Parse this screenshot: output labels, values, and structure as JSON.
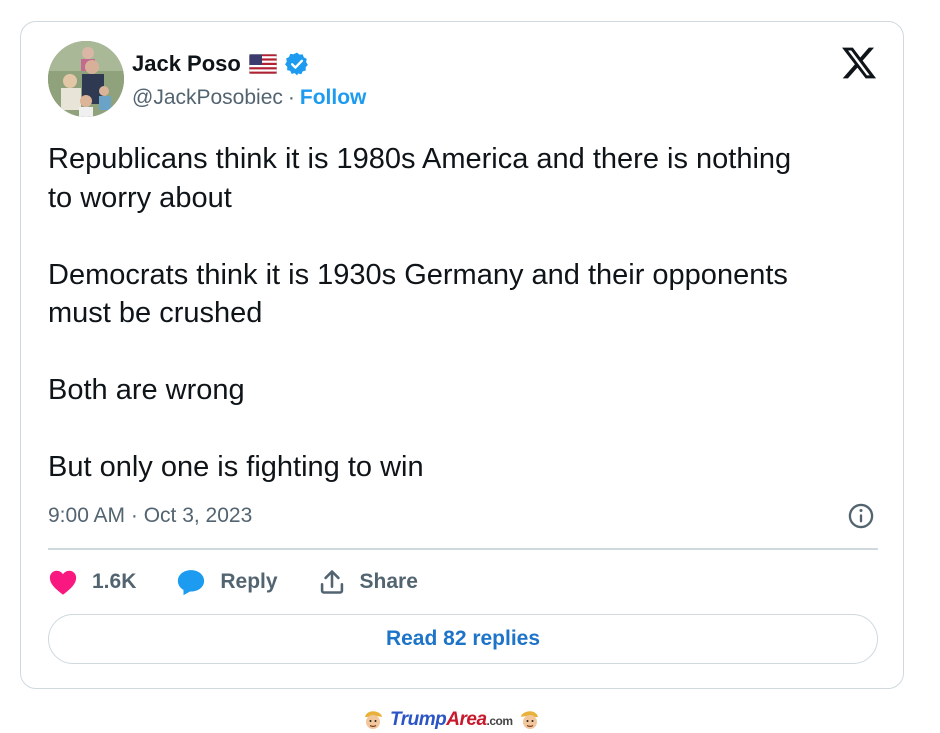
{
  "tweet": {
    "author": {
      "display_name": "Jack Poso",
      "handle": "@JackPosobiec",
      "separator": "·",
      "follow_label": "Follow"
    },
    "text": "Republicans think it is 1980s America and there is nothing\nto worry about\n\nDemocrats think it is 1930s Germany and their opponents\nmust be crushed\n\nBoth are wrong\n\nBut only one is fighting to win",
    "timestamp": "9:00 AM · Oct 3, 2023",
    "actions": {
      "like_count": "1.6K",
      "reply_label": "Reply",
      "share_label": "Share"
    },
    "read_replies_label": "Read 82 replies"
  },
  "footer": {
    "brand_primary": "Trump",
    "brand_secondary": "Area",
    "brand_suffix": ".com"
  },
  "icons": {
    "flag": "us-flag-icon",
    "verified": "verified-badge-icon",
    "logo": "x-logo-icon",
    "info": "info-icon",
    "like": "heart-icon",
    "reply": "speech-bubble-icon",
    "share": "share-icon"
  },
  "colors": {
    "accent_blue": "#1d9bf0",
    "read_replies_blue": "#1d74c9",
    "heart_pink": "#f91880",
    "secondary_text": "#536471",
    "border": "#cfd9de",
    "brand_blue": "#2b54c4",
    "brand_red": "#c8182c"
  }
}
